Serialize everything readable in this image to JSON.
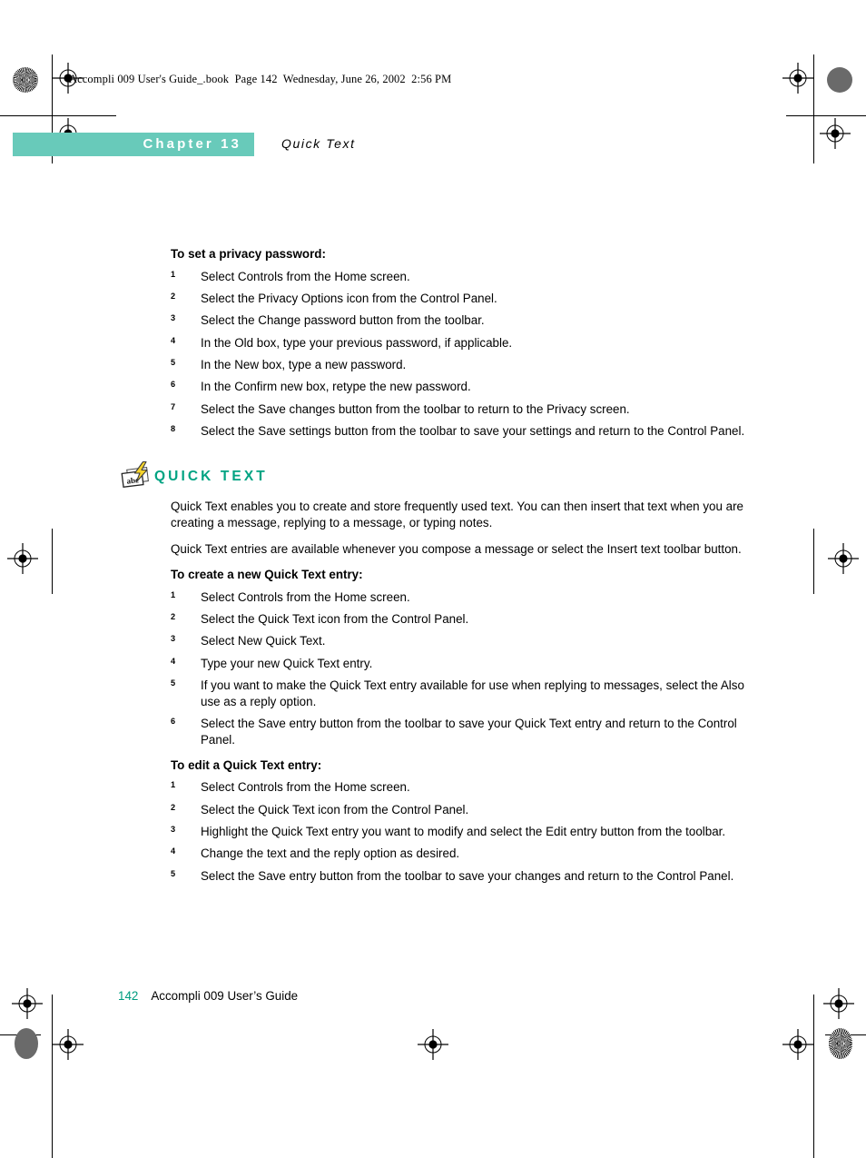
{
  "print_header": {
    "text": "Accompli 009 User's Guide_.book  Page 142  Wednesday, June 26, 2002  2:56 PM"
  },
  "chapter_banner": {
    "label": "Chapter 13",
    "title": "Quick Text",
    "banner_color": "#68CABA"
  },
  "sections": {
    "privacy": {
      "heading": "To set a privacy password:",
      "steps": [
        {
          "num": "1",
          "text": "Select Controls from the Home screen."
        },
        {
          "num": "2",
          "text": "Select the Privacy Options icon from the Control Panel."
        },
        {
          "num": "3",
          "text": "Select the Change password button from the toolbar."
        },
        {
          "num": "4",
          "text": "In the Old box, type your previous password, if applicable."
        },
        {
          "num": "5",
          "text": "In the New box, type a new password."
        },
        {
          "num": "6",
          "text": "In the Confirm new box, retype the new password."
        },
        {
          "num": "7",
          "text": "Select the Save changes button from the toolbar to return to the Privacy screen."
        },
        {
          "num": "8",
          "text": "Select the Save settings button from the toolbar to save your settings and return to the Control Panel."
        }
      ]
    },
    "quick_text": {
      "title": "QUICK TEXT",
      "title_color": "#00A382",
      "icon": "quick-text-icon",
      "paragraphs": [
        "Quick Text enables you to create and store frequently used text. You can then insert that text when you are creating a message, replying to a message, or typing notes.",
        "Quick Text entries are available whenever you compose a message or select the Insert text toolbar button."
      ]
    },
    "create_entry": {
      "heading": "To create a new Quick Text entry:",
      "steps": [
        {
          "num": "1",
          "text": "Select Controls from the Home screen."
        },
        {
          "num": "2",
          "text": "Select the Quick Text icon from the Control Panel."
        },
        {
          "num": "3",
          "text": "Select New Quick Text."
        },
        {
          "num": "4",
          "text": "Type your new Quick Text entry."
        },
        {
          "num": "5",
          "text": "If you want to make the Quick Text entry available for use when replying to messages, select the Also use as a reply option."
        },
        {
          "num": "6",
          "text": "Select the Save entry button from the toolbar to save your Quick Text entry and return to the Control Panel."
        }
      ]
    },
    "edit_entry": {
      "heading": "To edit a Quick Text entry:",
      "steps": [
        {
          "num": "1",
          "text": "Select Controls from the Home screen."
        },
        {
          "num": "2",
          "text": "Select the Quick Text icon from the Control Panel."
        },
        {
          "num": "3",
          "text": "Highlight the Quick Text entry you want to modify and select the Edit entry button from the toolbar."
        },
        {
          "num": "4",
          "text": "Change the text and the reply option as desired."
        },
        {
          "num": "5",
          "text": "Select the Save entry button from the toolbar to save your changes and return to the Control Panel."
        }
      ]
    }
  },
  "footer": {
    "page_number": "142",
    "guide_title": "Accompli 009 User’s Guide",
    "page_number_color": "#009C80"
  }
}
